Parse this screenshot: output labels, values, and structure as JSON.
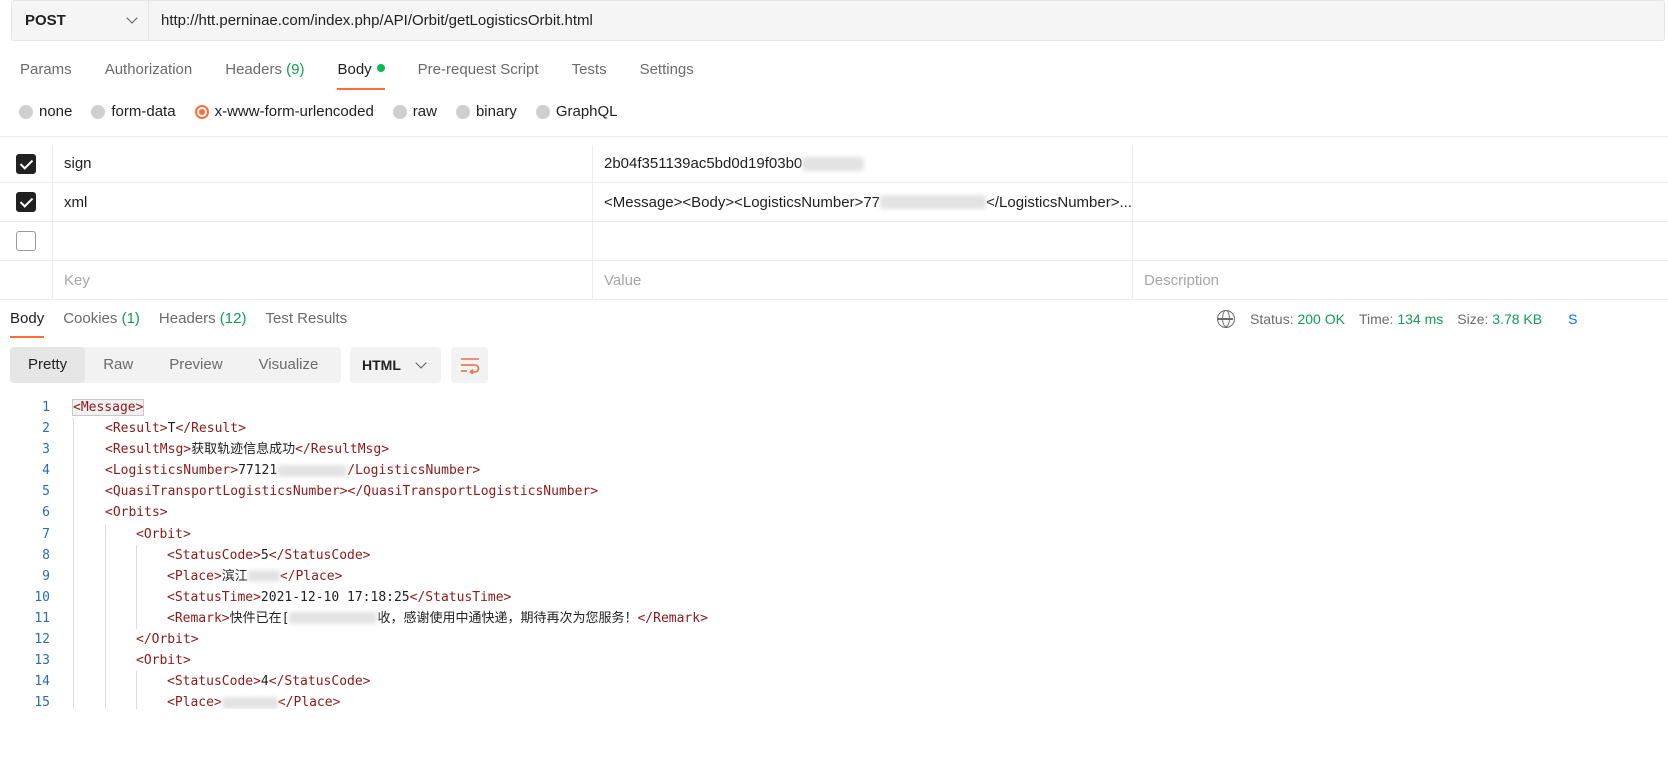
{
  "request": {
    "method": "POST",
    "url": "http://htt.perninae.com/index.php/API/Orbit/getLogisticsOrbit.html"
  },
  "request_tabs": [
    {
      "label": "Params",
      "count": ""
    },
    {
      "label": "Authorization",
      "count": ""
    },
    {
      "label": "Headers",
      "count": "(9)"
    },
    {
      "label": "Body",
      "count": ""
    },
    {
      "label": "Pre-request Script",
      "count": ""
    },
    {
      "label": "Tests",
      "count": ""
    },
    {
      "label": "Settings",
      "count": ""
    }
  ],
  "body_types": [
    "none",
    "form-data",
    "x-www-form-urlencoded",
    "raw",
    "binary",
    "GraphQL"
  ],
  "params": {
    "rows": [
      {
        "key": "sign",
        "value": "2b04f351139ac5bd0d19f03b0",
        "checked": true
      },
      {
        "key": "xml",
        "value": "<Message><Body><LogisticsNumber>77",
        "value_end": "</LogisticsNumber>...",
        "checked": true
      }
    ],
    "placeholder": {
      "key": "Key",
      "value": "Value",
      "description": "Description"
    }
  },
  "response_tabs": [
    {
      "label": "Body",
      "count": ""
    },
    {
      "label": "Cookies",
      "count": "(1)"
    },
    {
      "label": "Headers",
      "count": "(12)"
    },
    {
      "label": "Test Results",
      "count": ""
    }
  ],
  "status": {
    "status_label": "Status:",
    "status_value": "200 OK",
    "time_label": "Time:",
    "time_value": "134 ms",
    "size_label": "Size:",
    "size_value": "3.78 KB",
    "cut_label": "S"
  },
  "views": [
    "Pretty",
    "Raw",
    "Preview",
    "Visualize"
  ],
  "language": "HTML",
  "code_lines": [
    {
      "n": "1",
      "open": "<Message>",
      "text": "",
      "close": ""
    },
    {
      "n": "2",
      "open": "<Result>",
      "text": "T",
      "close": "</Result>"
    },
    {
      "n": "3",
      "open": "<ResultMsg>",
      "text": "获取轨迹信息成功",
      "close": "</ResultMsg>"
    },
    {
      "n": "4",
      "open": "<LogisticsNumber>",
      "text": "77121",
      "close": "/LogisticsNumber>"
    },
    {
      "n": "5",
      "open": "<QuasiTransportLogisticsNumber>",
      "text": "",
      "close": "</QuasiTransportLogisticsNumber>"
    },
    {
      "n": "6",
      "open": "<Orbits>",
      "text": "",
      "close": ""
    },
    {
      "n": "7",
      "open": "<Orbit>",
      "text": "",
      "close": ""
    },
    {
      "n": "8",
      "open": "<StatusCode>",
      "text": "5",
      "close": "</StatusCode>"
    },
    {
      "n": "9",
      "open": "<Place>",
      "text": "滨江",
      "close": "</Place>"
    },
    {
      "n": "10",
      "open": "<StatusTime>",
      "text": "2021-12-10 17:18:25",
      "close": "</StatusTime>"
    },
    {
      "n": "11",
      "open": "<Remark>",
      "text": "快件已在[",
      "text2": "收，感谢使用中通快递，期待再次为您服务！",
      "close": "</Remark>"
    },
    {
      "n": "12",
      "open": "",
      "text": "",
      "close": "</Orbit>"
    },
    {
      "n": "13",
      "open": "<Orbit>",
      "text": "",
      "close": ""
    },
    {
      "n": "14",
      "open": "<StatusCode>",
      "text": "4",
      "close": "</StatusCode>"
    },
    {
      "n": "15",
      "open": "<Place>",
      "text": "",
      "close": "</Place>"
    }
  ]
}
